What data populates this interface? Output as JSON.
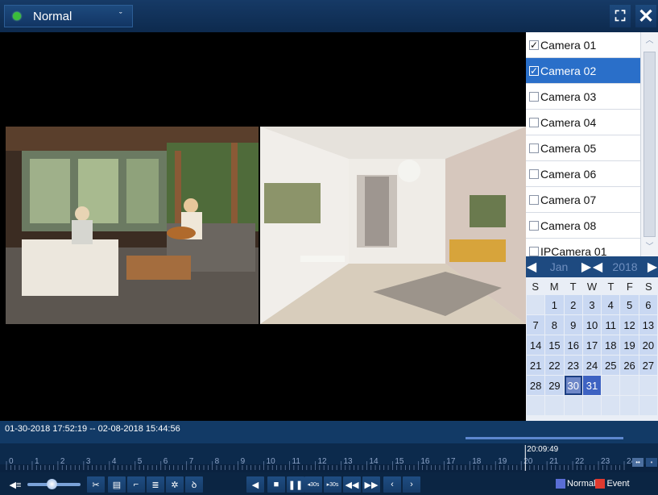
{
  "topbar": {
    "mode_label": "Normal",
    "mode_icon": "play-dot-icon",
    "fullscreen_icon": "fullscreen-icon",
    "close_icon": "close-icon"
  },
  "cameras": [
    {
      "label": "Camera 01",
      "checked": true,
      "selected": false
    },
    {
      "label": "Camera 02",
      "checked": true,
      "selected": true
    },
    {
      "label": "Camera 03",
      "checked": false,
      "selected": false
    },
    {
      "label": "Camera 04",
      "checked": false,
      "selected": false
    },
    {
      "label": "Camera 05",
      "checked": false,
      "selected": false
    },
    {
      "label": "Camera 06",
      "checked": false,
      "selected": false
    },
    {
      "label": "Camera 07",
      "checked": false,
      "selected": false
    },
    {
      "label": "Camera 08",
      "checked": false,
      "selected": false
    },
    {
      "label": "IPCamera 01",
      "checked": false,
      "selected": false
    }
  ],
  "calendar": {
    "month": "Jan",
    "year": "2018",
    "weekdays": [
      "S",
      "M",
      "T",
      "W",
      "T",
      "F",
      "S"
    ],
    "days": [
      {
        "d": "",
        "s": "empty"
      },
      {
        "d": "1",
        "s": "record"
      },
      {
        "d": "2",
        "s": "record"
      },
      {
        "d": "3",
        "s": "record"
      },
      {
        "d": "4",
        "s": "record"
      },
      {
        "d": "5",
        "s": "record"
      },
      {
        "d": "6",
        "s": "record"
      },
      {
        "d": "7",
        "s": "record"
      },
      {
        "d": "8",
        "s": "record"
      },
      {
        "d": "9",
        "s": "record"
      },
      {
        "d": "10",
        "s": "record"
      },
      {
        "d": "11",
        "s": "record"
      },
      {
        "d": "12",
        "s": "record"
      },
      {
        "d": "13",
        "s": "record"
      },
      {
        "d": "14",
        "s": "record"
      },
      {
        "d": "15",
        "s": "record"
      },
      {
        "d": "16",
        "s": "record"
      },
      {
        "d": "17",
        "s": "record"
      },
      {
        "d": "18",
        "s": "record"
      },
      {
        "d": "19",
        "s": "record"
      },
      {
        "d": "20",
        "s": "record"
      },
      {
        "d": "21",
        "s": "record"
      },
      {
        "d": "22",
        "s": "record"
      },
      {
        "d": "23",
        "s": "record"
      },
      {
        "d": "24",
        "s": "record"
      },
      {
        "d": "25",
        "s": "record"
      },
      {
        "d": "26",
        "s": "record"
      },
      {
        "d": "27",
        "s": "record"
      },
      {
        "d": "28",
        "s": "record"
      },
      {
        "d": "29",
        "s": "record"
      },
      {
        "d": "30",
        "s": "today"
      },
      {
        "d": "31",
        "s": "sel"
      },
      {
        "d": "",
        "s": "empty"
      },
      {
        "d": "",
        "s": "empty"
      },
      {
        "d": "",
        "s": "empty"
      },
      {
        "d": "",
        "s": "empty"
      },
      {
        "d": "",
        "s": "empty"
      },
      {
        "d": "",
        "s": "empty"
      },
      {
        "d": "",
        "s": "empty"
      },
      {
        "d": "",
        "s": "empty"
      },
      {
        "d": "",
        "s": "empty"
      },
      {
        "d": "",
        "s": "empty"
      }
    ]
  },
  "playback": {
    "range_text": "01-30-2018 17:52:19 -- 02-08-2018 15:44:56",
    "cursor_time": "20:09:49",
    "hour_ticks": [
      "0",
      "1",
      "2",
      "3",
      "4",
      "5",
      "6",
      "7",
      "8",
      "9",
      "10",
      "11",
      "12",
      "13",
      "14",
      "15",
      "16",
      "17",
      "18",
      "19",
      "20",
      "21",
      "22",
      "23",
      "24"
    ],
    "cursor_hour": 20.16
  },
  "controls": {
    "volume_fraction": 0.45,
    "buttons": [
      {
        "name": "audio-button",
        "icon": "audio-icon",
        "glyph": "◀≡"
      },
      {
        "name": "clip-button",
        "icon": "scissors-icon",
        "glyph": "✂"
      },
      {
        "name": "save-clip-button",
        "icon": "folder-save-icon",
        "glyph": "▤"
      },
      {
        "name": "tag-button",
        "icon": "tag-icon",
        "glyph": "⌐"
      },
      {
        "name": "custom-tag-button",
        "icon": "tag-edit-icon",
        "glyph": "≣"
      },
      {
        "name": "settings-button",
        "icon": "gear-icon",
        "glyph": "✲"
      },
      {
        "name": "digital-zoom-button",
        "icon": "zoom-icon",
        "glyph": "ꝺ"
      },
      {
        "name": "reverse-play-button",
        "icon": "reverse-play-icon",
        "glyph": "◀"
      },
      {
        "name": "stop-button",
        "icon": "stop-icon",
        "glyph": "■"
      },
      {
        "name": "pause-button",
        "icon": "pause-icon",
        "glyph": "❚❚"
      },
      {
        "name": "back-30s-button",
        "icon": "back-30s-icon",
        "glyph": "◂30s"
      },
      {
        "name": "forward-30s-button",
        "icon": "forward-30s-icon",
        "glyph": "▸30s"
      },
      {
        "name": "slow-button",
        "icon": "slow-icon",
        "glyph": "◀◀"
      },
      {
        "name": "fast-button",
        "icon": "fast-icon",
        "glyph": "▶▶"
      },
      {
        "name": "prev-day-button",
        "icon": "prev-icon",
        "glyph": "‹"
      },
      {
        "name": "next-day-button",
        "icon": "next-icon",
        "glyph": "›"
      }
    ],
    "legend": [
      {
        "label": "Normal",
        "color": "#5a6ed6"
      },
      {
        "label": "Event",
        "color": "#e03a2f"
      }
    ]
  }
}
